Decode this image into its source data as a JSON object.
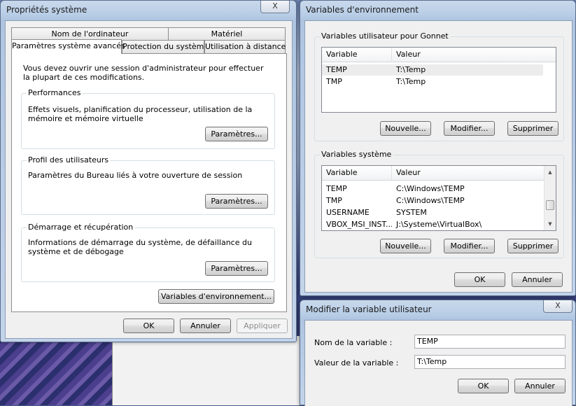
{
  "sysprops": {
    "title": "Propriétés système",
    "close_label": "X",
    "tabs_top": [
      "Nom de l'ordinateur",
      "Matériel"
    ],
    "tabs_bottom": [
      "Paramètres système avancés",
      "Protection du système",
      "Utilisation à distance"
    ],
    "intro": "Vous devez ouvrir une session d'administrateur pour effectuer la plupart de ces modifications.",
    "performances": {
      "label": "Performances",
      "desc": "Effets visuels, planification du processeur, utilisation de la mémoire et mémoire virtuelle",
      "button": "Paramètres..."
    },
    "profil": {
      "label": "Profil des utilisateurs",
      "desc": "Paramètres du Bureau liés à votre ouverture de session",
      "button": "Paramètres..."
    },
    "demarrage": {
      "label": "Démarrage et récupération",
      "desc": "Informations de démarrage du système, de défaillance du système et de débogage",
      "button": "Paramètres..."
    },
    "envvars_button": "Variables d'environnement...",
    "ok": "OK",
    "cancel": "Annuler",
    "apply": "Appliquer"
  },
  "envvars": {
    "title": "Variables d'environnement",
    "user_group": "Variables utilisateur pour Gonnet",
    "col_variable": "Variable",
    "col_value": "Valeur",
    "user_rows": [
      {
        "name": "TEMP",
        "value": "T:\\Temp"
      },
      {
        "name": "TMP",
        "value": "T:\\Temp"
      }
    ],
    "system_group": "Variables système",
    "system_rows": [
      {
        "name": "TEMP",
        "value": "C:\\Windows\\TEMP"
      },
      {
        "name": "TMP",
        "value": "C:\\Windows\\TEMP"
      },
      {
        "name": "USERNAME",
        "value": "SYSTEM"
      },
      {
        "name": "VBOX_MSI_INST...",
        "value": "J:\\Systeme\\VirtualBox\\"
      }
    ],
    "new": "Nouvelle...",
    "edit": "Modifier...",
    "delete": "Supprimer",
    "ok": "OK",
    "cancel": "Annuler"
  },
  "editvar": {
    "title": "Modifier la variable utilisateur",
    "close_label": "X",
    "name_label": "Nom de la variable :",
    "name_value": "TEMP",
    "value_label": "Valeur de la variable :",
    "value_value": "T:\\Temp",
    "ok": "OK",
    "cancel": "Annuler"
  }
}
